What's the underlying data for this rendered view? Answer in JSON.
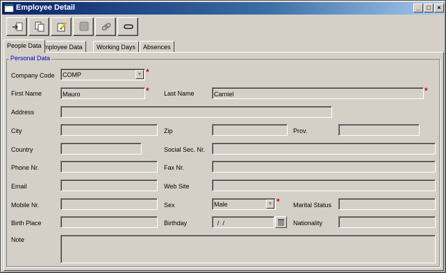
{
  "window": {
    "title": "Employee Detail",
    "controls": {
      "minimize": "_",
      "maximize": "□",
      "close": "×"
    }
  },
  "toolbar": {
    "buttons": [
      {
        "icon": "import-icon"
      },
      {
        "icon": "copy-icon"
      },
      {
        "icon": "edit-icon"
      },
      {
        "icon": "stop-icon"
      },
      {
        "icon": "link-icon"
      },
      {
        "icon": "unlink-icon"
      }
    ]
  },
  "tabs": [
    "People Data",
    "Employee Data",
    "Working Days",
    "Absences"
  ],
  "group": {
    "legend": "Personal Data"
  },
  "form": {
    "company_code": {
      "label": "Company Code",
      "value": "COMP"
    },
    "first_name": {
      "label": "First Name",
      "value": "Mauro"
    },
    "last_name": {
      "label": "Last Name",
      "value": "Carniel"
    },
    "address": {
      "label": "Address",
      "value": ""
    },
    "city": {
      "label": "City",
      "value": ""
    },
    "zip": {
      "label": "Zip",
      "value": ""
    },
    "prov": {
      "label": "Prov.",
      "value": ""
    },
    "country": {
      "label": "Country",
      "value": ""
    },
    "social_sec": {
      "label": "Social Sec. Nr.",
      "value": ""
    },
    "phone": {
      "label": "Phone Nr.",
      "value": ""
    },
    "fax": {
      "label": "Fax Nr.",
      "value": ""
    },
    "email": {
      "label": "Email",
      "value": ""
    },
    "website": {
      "label": "Web Site",
      "value": ""
    },
    "mobile": {
      "label": "Mobile Nr.",
      "value": ""
    },
    "sex": {
      "label": "Sex",
      "value": "Male"
    },
    "marital_status": {
      "label": "Marital Status",
      "value": ""
    },
    "birth_place": {
      "label": "Birth Place",
      "value": ""
    },
    "birthday": {
      "label": "Birthday",
      "value": "  /  /"
    },
    "nationality": {
      "label": "Nationality",
      "value": ""
    },
    "note": {
      "label": "Note",
      "value": ""
    }
  },
  "required_marker": "*",
  "colors": {
    "required": "#e00000",
    "legend": "#0000c0",
    "title_start": "#0a246a",
    "title_end": "#a6caf0"
  }
}
